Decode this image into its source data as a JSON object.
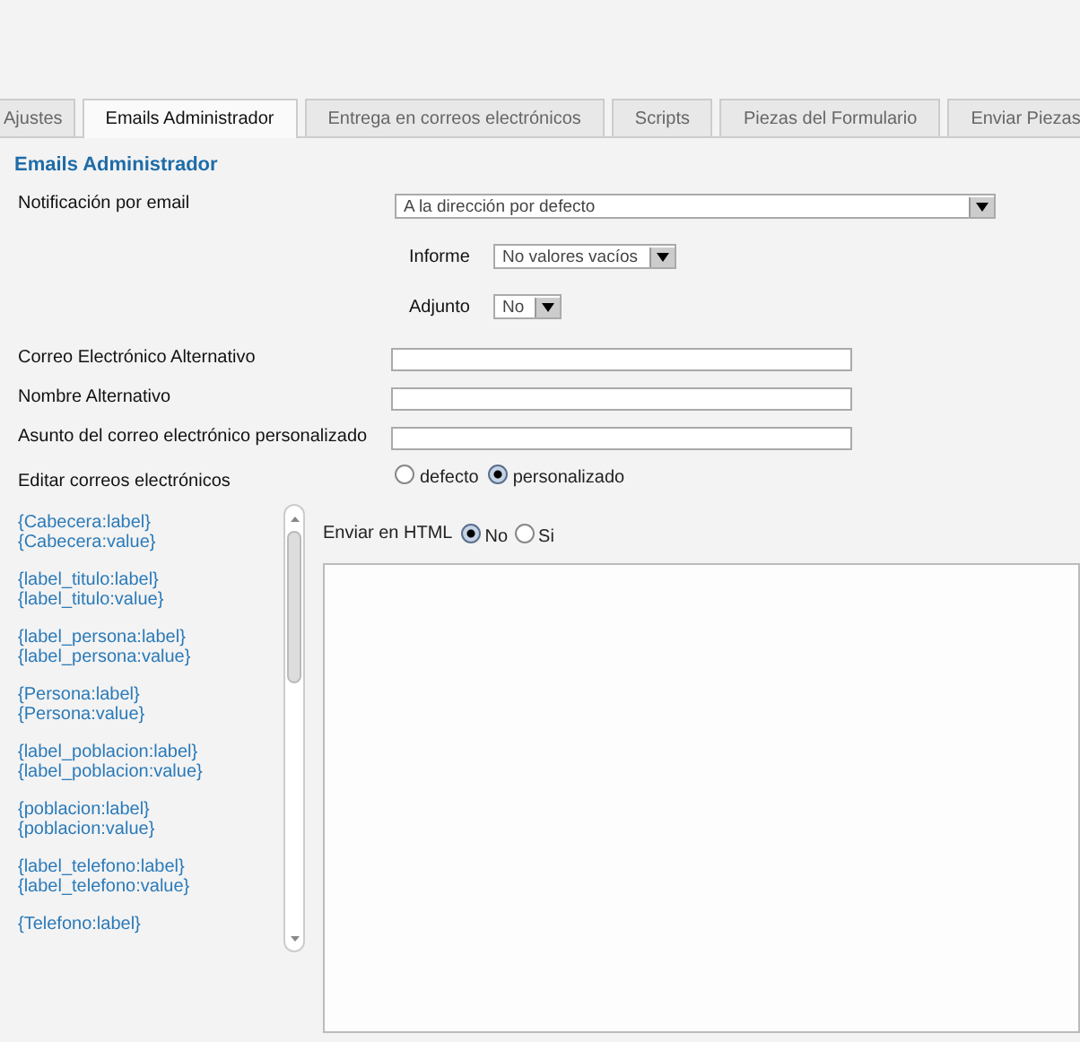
{
  "tabs": [
    {
      "label": "Ajustes",
      "selected": false
    },
    {
      "label": "Emails Administrador",
      "selected": true
    },
    {
      "label": "Entrega en correos electrónicos",
      "selected": false
    },
    {
      "label": "Scripts",
      "selected": false
    },
    {
      "label": "Piezas del Formulario",
      "selected": false
    },
    {
      "label": "Enviar Piezas",
      "selected": false
    }
  ],
  "heading": "Emails Administrador",
  "notification": {
    "label": "Notificación por email",
    "value": "A la dirección por defecto"
  },
  "sub_options": [
    {
      "label": "Informe",
      "value": "No valores vacíos"
    },
    {
      "label": "Adjunto",
      "value": "No"
    }
  ],
  "fields": [
    {
      "label": "Correo Electrónico Alternativo"
    },
    {
      "label": "Nombre Alternativo"
    },
    {
      "label": "Asunto del correo electrónico personalizado"
    }
  ],
  "edit_emails": {
    "label": "Editar correos electrónicos",
    "options": [
      {
        "label": "defecto",
        "selected": false
      },
      {
        "label": "personalizado",
        "selected": true
      }
    ]
  },
  "placeholders": [
    [
      "{Cabecera:label}",
      "{Cabecera:value}"
    ],
    [
      "{label_titulo:label}",
      "{label_titulo:value}"
    ],
    [
      "{label_persona:label}",
      "{label_persona:value}"
    ],
    [
      "{Persona:label}",
      "{Persona:value}"
    ],
    [
      "{label_poblacion:label}",
      "{label_poblacion:value}"
    ],
    [
      "{poblacion:label}",
      "{poblacion:value}"
    ],
    [
      "{label_telefono:label}",
      "{label_telefono:value}"
    ],
    [
      "{Telefono:label}"
    ]
  ],
  "html": {
    "label": "Enviar en HTML",
    "options": [
      {
        "label": "No",
        "selected": true
      },
      {
        "label": "Si",
        "selected": false
      }
    ]
  }
}
